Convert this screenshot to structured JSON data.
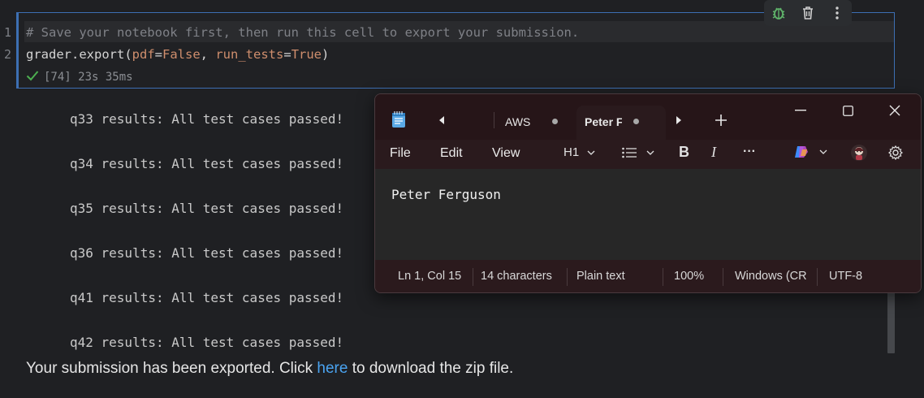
{
  "code_cell": {
    "line_numbers": [
      "1",
      "2"
    ],
    "line1_comment": "# Save your notebook first, then run this cell to export your submission.",
    "line2": {
      "func": "grader.export(",
      "p1": "pdf",
      "eq1": "=",
      "v1": "False",
      "sep": ", ",
      "p2": "run_tests",
      "eq2": "=",
      "v2": "True",
      "close": ")"
    },
    "exec_status": "[74] 23s 35ms"
  },
  "cell_toolbar": {
    "icons": [
      "debug-icon",
      "trash-icon",
      "more-vertical-icon"
    ]
  },
  "output": {
    "lines": [
      "q33 results: All test cases passed!",
      "q34 results: All test cases passed!",
      "q35 results: All test cases passed!",
      "q36 results: All test cases passed!",
      "q41 results: All test cases passed!",
      "q42 results: All test cases passed!"
    ],
    "export_before": "Your submission has been exported. Click ",
    "export_link": "here",
    "export_after": " to download the zip file."
  },
  "notepad": {
    "tabs": [
      {
        "label": "AWS",
        "modified": true,
        "active": false
      },
      {
        "label": "Peter F",
        "modified": true,
        "active": true
      }
    ],
    "menu": [
      "File",
      "Edit",
      "View"
    ],
    "format": {
      "heading": "H1",
      "bold": "B",
      "italic": "I",
      "more": "···"
    },
    "editor_text": "Peter Ferguson",
    "status": {
      "position": "Ln 1, Col 15",
      "chars": "14 characters",
      "format": "Plain text",
      "zoom": "100%",
      "line_ending": "Windows (CR",
      "encoding": "UTF-8"
    },
    "colors": {
      "titlebar": "#261518",
      "accent_link": "#4aa3f0"
    }
  }
}
